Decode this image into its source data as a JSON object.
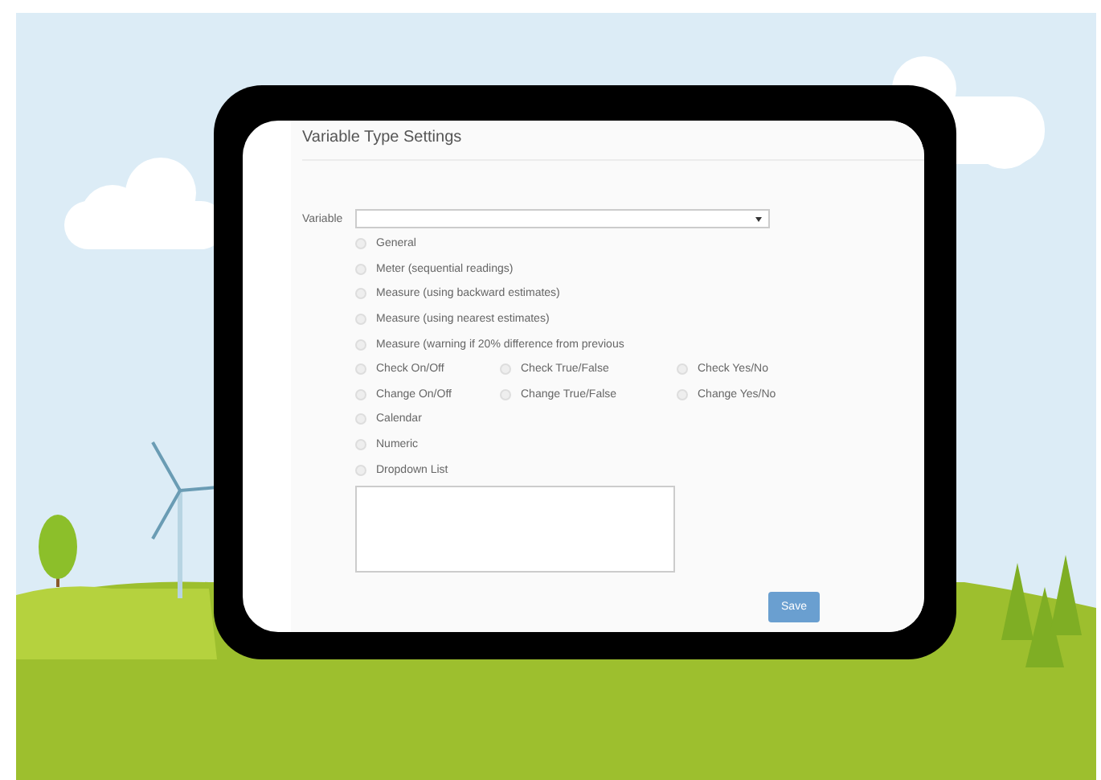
{
  "panel": {
    "title": "Variable Type Settings"
  },
  "variable_field": {
    "label": "Variable"
  },
  "type_options": [
    [
      {
        "label": "General",
        "selected": false
      }
    ],
    [
      {
        "label": "Meter (sequential readings)",
        "selected": false
      }
    ],
    [
      {
        "label": "Measure (using backward estimates)",
        "selected": false
      }
    ],
    [
      {
        "label": "Measure (using nearest estimates)",
        "selected": false
      }
    ],
    [
      {
        "label": "Measure (warning if 20% difference from previous",
        "selected": false
      }
    ],
    [
      {
        "label": "Check On/Off",
        "selected": false
      },
      {
        "label": "Check True/False",
        "selected": false
      },
      {
        "label": "Check Yes/No",
        "selected": false
      }
    ],
    [
      {
        "label": "Change On/Off",
        "selected": false
      },
      {
        "label": "Change True/False",
        "selected": false
      },
      {
        "label": "Change Yes/No",
        "selected": false
      }
    ],
    [
      {
        "label": "Calendar",
        "selected": false
      }
    ],
    [
      {
        "label": "Numeric",
        "selected": false
      }
    ],
    [
      {
        "label": "Dropdown List",
        "selected": false
      }
    ]
  ],
  "save_button": {
    "label": "Save",
    "disabled": true
  }
}
